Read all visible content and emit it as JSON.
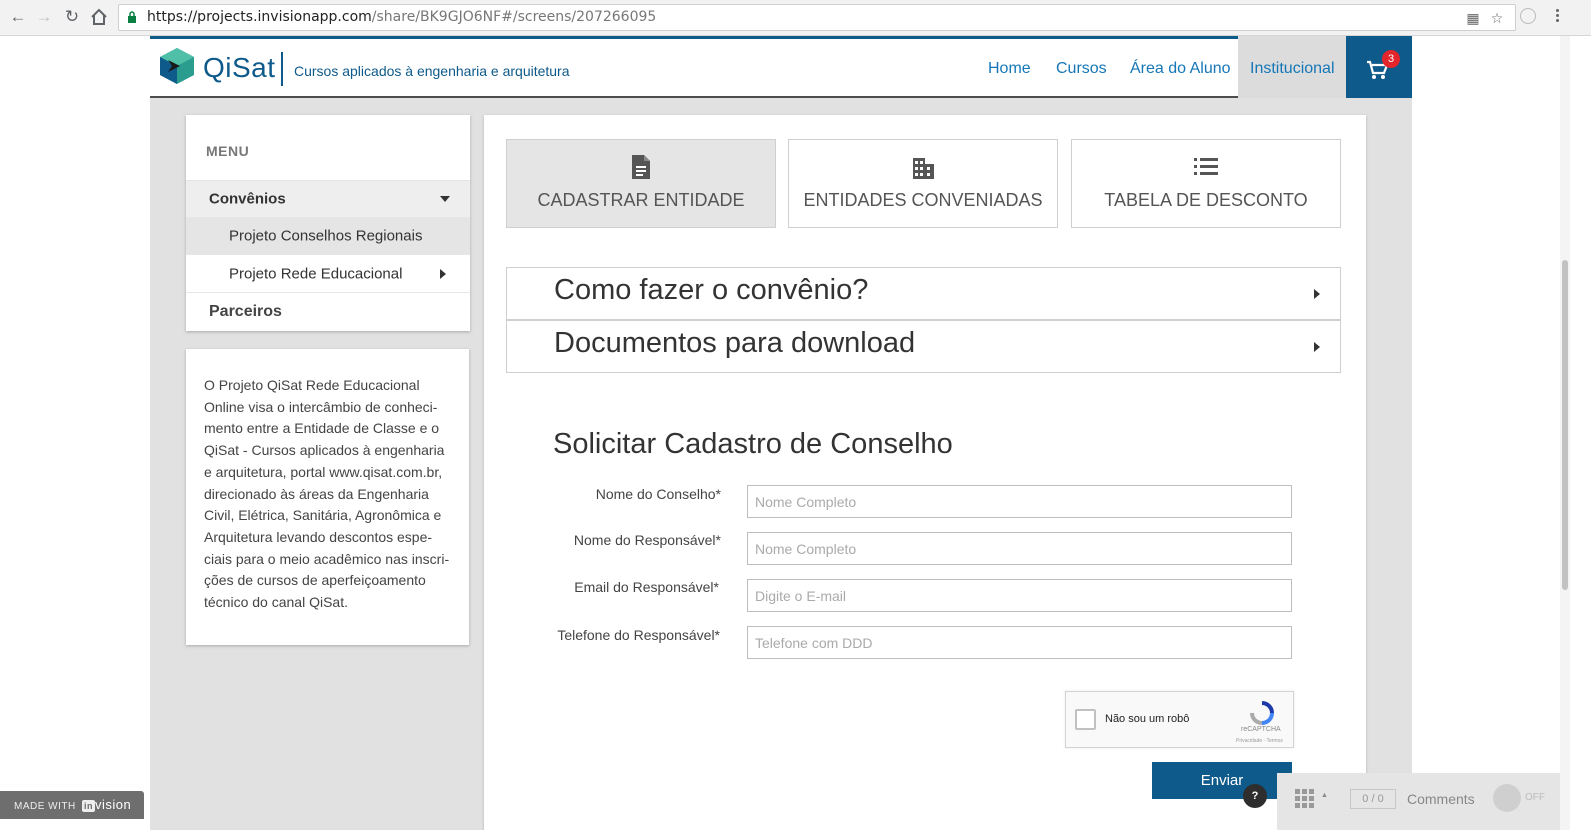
{
  "browser": {
    "url_host": "https://projects.invisionapp.com",
    "url_path": "/share/BK9GJO6NF#/screens/207266095"
  },
  "header": {
    "logo": "QiSat",
    "tagline": "Cursos aplicados à engenharia e arquitetura",
    "nav": [
      "Home",
      "Cursos",
      "Área do Aluno",
      "Institucional"
    ],
    "cart_count": "3",
    "colors": {
      "brand": "#0e5a8a",
      "link": "#1577b8",
      "badge": "#e4262c"
    }
  },
  "sidebar": {
    "menu_title": "MENU",
    "items": [
      {
        "label": "Convênios"
      },
      {
        "label": "Projeto Conselhos Regionais"
      },
      {
        "label": "Projeto Rede Educacional"
      },
      {
        "label": "Parceiros"
      }
    ],
    "info_text": "O Projeto QiSat Rede Educacional Online visa o intercâmbio de conheci-mento entre a Entidade de Classe e o QiSat - Cursos aplicados à engenharia e arquitetura, portal www.qisat.com.br, direcionado às áreas da Engenharia Civil, Elétrica, Sanitária, Agronômica e Arquitetura levando descontos espe-ciais para o meio acadêmico nas inscri-ções de cursos de aperfeiçoamento técnico do canal QiSat."
  },
  "main": {
    "tiles": [
      {
        "label": "CADASTRAR ENTIDADE",
        "icon": "document-icon"
      },
      {
        "label": "ENTIDADES CONVENIADAS",
        "icon": "building-icon"
      },
      {
        "label": "TABELA DE DESCONTO",
        "icon": "list-icon"
      }
    ],
    "accordions": [
      "Como fazer o convênio?",
      "Documentos para download"
    ],
    "form": {
      "title": "Solicitar Cadastro de Conselho",
      "fields": [
        {
          "label": "Nome do Conselho*",
          "placeholder": "Nome Completo"
        },
        {
          "label": "Nome do Responsável*",
          "placeholder": "Nome Completo"
        },
        {
          "label": "Email do Responsável*",
          "placeholder": "Digite o E-mail"
        },
        {
          "label": "Telefone do Responsável*",
          "placeholder": "Telefone com DDD"
        }
      ],
      "captcha": {
        "label": "Não sou um robô",
        "brand": "reCAPTCHA",
        "terms": "Privacidade - Termos"
      },
      "submit": "Enviar"
    }
  },
  "invision": {
    "made_with": "MADE WITH",
    "badge": "in",
    "badge_word": "vision",
    "help": "?",
    "counter": "0 / 0",
    "comments": "Comments",
    "toggle": "OFF"
  }
}
